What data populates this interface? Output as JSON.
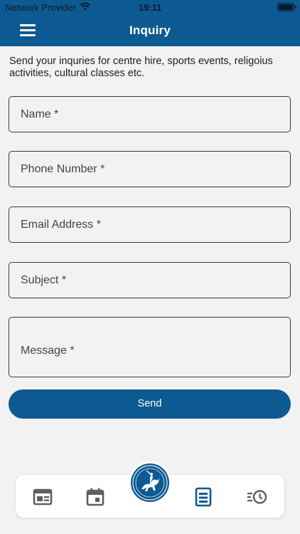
{
  "status_bar": {
    "provider": "Network Provider",
    "time": "19:11"
  },
  "header": {
    "title": "Inquiry"
  },
  "intro_text": "Send your inquries for centre hire, sports events, religoius activities, cultural classes etc.",
  "form": {
    "name_placeholder": "Name *",
    "phone_placeholder": "Phone Number *",
    "email_placeholder": "Email Address *",
    "subject_placeholder": "Subject *",
    "message_placeholder": "Message *",
    "send_label": "Send"
  },
  "tab_bar": {
    "tabs": [
      {
        "icon": "news-icon",
        "active": false
      },
      {
        "icon": "calendar-icon",
        "active": false
      },
      {
        "icon": "logo-emblem",
        "active": false
      },
      {
        "icon": "inquiry-form-icon",
        "active": true
      },
      {
        "icon": "history-icon",
        "active": false
      }
    ]
  },
  "colors": {
    "primary": "#0d5a92",
    "background": "#f2f2f2",
    "icon_inactive": "#5f5f5f",
    "icon_active": "#0d5a92"
  }
}
